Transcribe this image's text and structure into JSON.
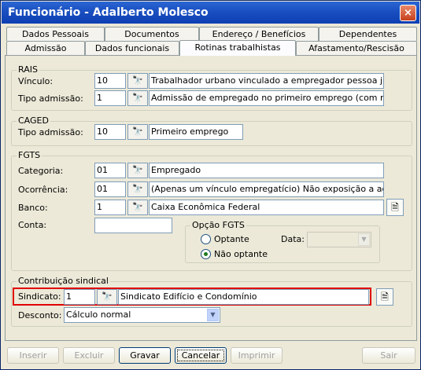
{
  "window": {
    "title": "Funcionário - Adalberto Molesco",
    "close_label": "×"
  },
  "tabs_row1": [
    "Dados Pessoais",
    "Documentos",
    "Endereço / Benefícios",
    "Dependentes"
  ],
  "tabs_row2": [
    "Admissão",
    "Dados funcionais",
    "Rotinas trabalhistas",
    "Afastamento/Rescisão"
  ],
  "rais": {
    "title": "RAIS",
    "vinculo_label": "Vínculo:",
    "vinculo_code": "10",
    "vinculo_desc": "Trabalhador urbano vinculado a empregador pessoa jurídica p",
    "tipo_label": "Tipo admissão:",
    "tipo_code": "1",
    "tipo_desc": "Admissão de empregado no primeiro emprego (com registro)"
  },
  "caged": {
    "title": "CAGED",
    "tipo_label": "Tipo admissão:",
    "tipo_code": "10",
    "tipo_desc": "Primeiro emprego"
  },
  "fgts": {
    "title": "FGTS",
    "categoria_label": "Categoria:",
    "categoria_code": "01",
    "categoria_desc": "Empregado",
    "ocorrencia_label": "Ocorrência:",
    "ocorrencia_code": "01",
    "ocorrencia_desc": "(Apenas um vínculo empregatício) Não exposição a agente no",
    "banco_label": "Banco:",
    "banco_code": "1",
    "banco_desc": "Caixa Econômica Federal",
    "conta_label": "Conta:",
    "conta_value": "",
    "opcao_title": "Opção FGTS",
    "optante_label": "Optante",
    "nao_optante_label": "Não optante",
    "data_label": "Data:",
    "data_value": ""
  },
  "sindical": {
    "title": "Contribuição sindical",
    "sindicato_label": "Sindicato:",
    "sindicato_code": "1",
    "sindicato_desc": "Sindicato Edifício e Condomínio",
    "desconto_label": "Desconto:",
    "desconto_value": "Cálculo normal"
  },
  "buttons": {
    "inserir": "Inserir",
    "excluir": "Excluir",
    "gravar": "Gravar",
    "cancelar": "Cancelar",
    "imprimir": "Imprimir",
    "sair": "Sair"
  },
  "icons": {
    "search": "binoculars-icon",
    "doc": "document-icon"
  },
  "colors": {
    "titlebar": "#0d3fb3",
    "highlight": "#e00000"
  }
}
